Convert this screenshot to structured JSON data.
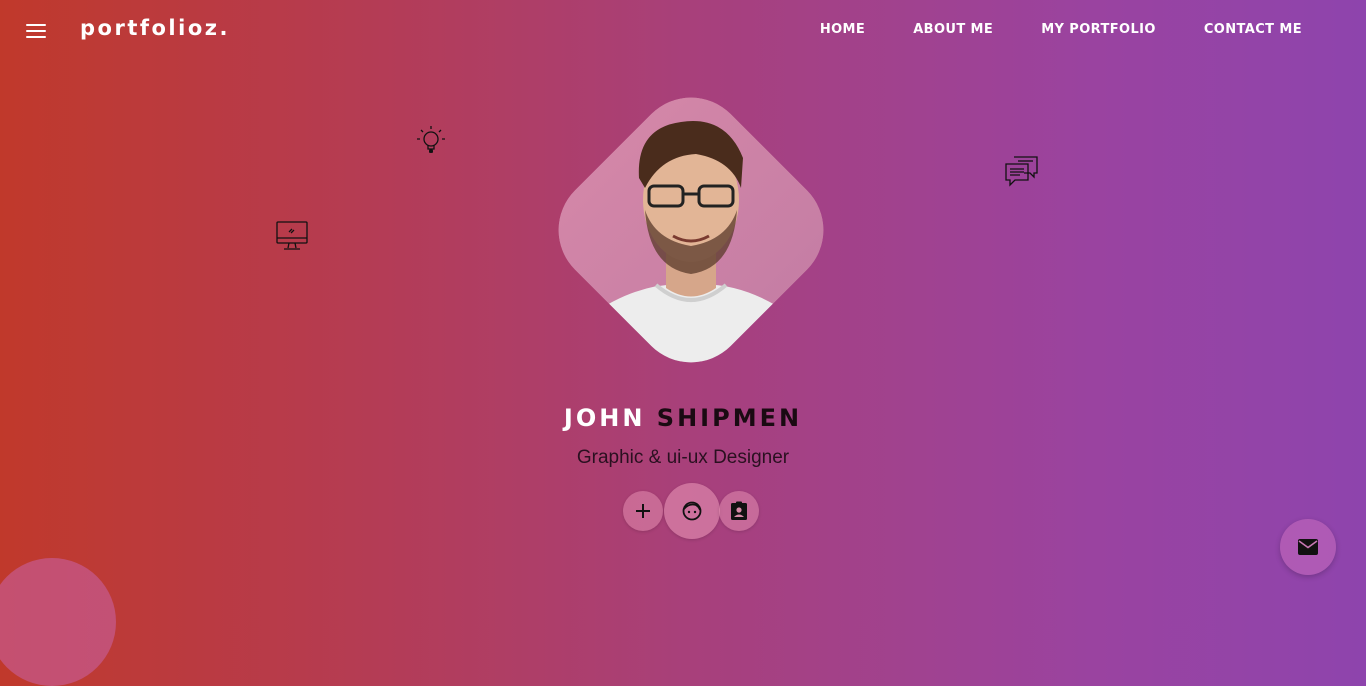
{
  "header": {
    "menu_icon": "hamburger-menu-icon",
    "logo": "portfolioz.",
    "nav": [
      {
        "label": "HOME"
      },
      {
        "label": "ABOUT ME"
      },
      {
        "label": "MY PORTFOLIO"
      },
      {
        "label": "CONTACT ME"
      }
    ]
  },
  "decorations": [
    "lightbulb-icon",
    "desktop-monitor-icon",
    "chat-bubbles-icon"
  ],
  "hero": {
    "first_name": "JOHN",
    "last_name": "SHIPMEN",
    "title": "Graphic & ui-ux Designer",
    "photo": "profile-photo"
  },
  "actions": [
    {
      "icon": "plus-icon"
    },
    {
      "icon": "face-icon"
    },
    {
      "icon": "contact-card-icon"
    }
  ],
  "fab": {
    "icon": "mail-icon"
  },
  "colors": {
    "gradient_start": "#c0392b",
    "gradient_end": "#8e44ad"
  }
}
